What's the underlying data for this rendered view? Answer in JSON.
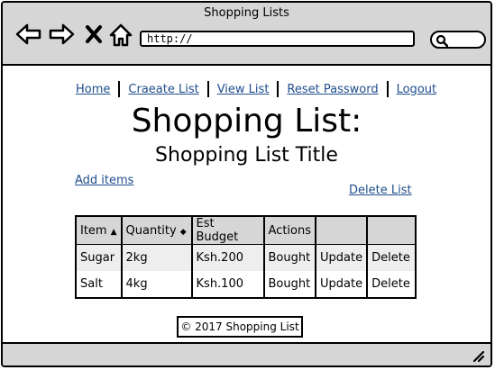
{
  "window": {
    "title": "Shopping Lists"
  },
  "browser": {
    "url": "http://"
  },
  "nav": {
    "links": [
      "Home",
      "Craeate List",
      "View List",
      "Reset Password",
      "Logout"
    ]
  },
  "page": {
    "heading": "Shopping List:",
    "subtitle": "Shopping List Title",
    "add_items": "Add items",
    "delete_list": "Delete List"
  },
  "table": {
    "headers": [
      "Item",
      "Quantity",
      "Est Budget",
      "Actions",
      "",
      ""
    ],
    "rows": [
      [
        "Sugar",
        "2kg",
        "Ksh.200",
        "Bought",
        "Update",
        "Delete"
      ],
      [
        "Salt",
        "4kg",
        "Ksh.100",
        "Bought",
        "Update",
        "Delete"
      ]
    ]
  },
  "footer": {
    "text": "© 2017 Shopping List"
  },
  "icons": {
    "back": "arrow-left-icon",
    "forward": "arrow-right-icon",
    "stop": "close-icon",
    "home": "home-icon",
    "search": "search-icon",
    "grip": "resize-grip-icon"
  }
}
